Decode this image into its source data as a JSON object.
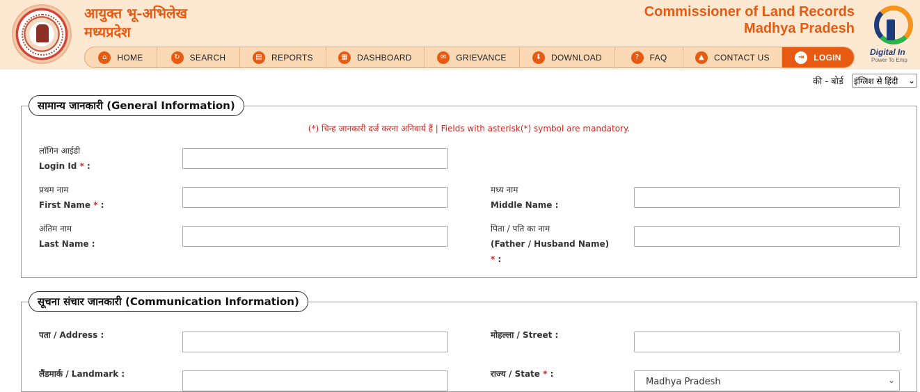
{
  "header": {
    "title_hi_line1": "आयुक्त भू-अभिलेख",
    "title_hi_line2": "मध्यप्रदेश",
    "title_en_line1": "Commissioner of Land Records",
    "title_en_line2": "Madhya Pradesh",
    "digital_india_text": "Digital In",
    "digital_india_sub": "Power To Emp"
  },
  "nav": {
    "items": [
      {
        "label": "HOME",
        "icon": "home-icon",
        "glyph": "⌂"
      },
      {
        "label": "SEARCH",
        "icon": "search-icon",
        "glyph": "↻"
      },
      {
        "label": "REPORTS",
        "icon": "reports-icon",
        "glyph": "▤"
      },
      {
        "label": "DASHBOARD",
        "icon": "dashboard-icon",
        "glyph": "▦"
      },
      {
        "label": "GRIEVANCE",
        "icon": "grievance-icon",
        "glyph": "✉"
      },
      {
        "label": "DOWNLOAD",
        "icon": "download-icon",
        "glyph": "⬇"
      },
      {
        "label": "FAQ",
        "icon": "faq-icon",
        "glyph": "?"
      },
      {
        "label": "CONTACT US",
        "icon": "contact-icon",
        "glyph": "▲"
      },
      {
        "label": "LOGIN",
        "icon": "login-icon",
        "glyph": "⇥"
      }
    ],
    "active_color": "#e65a12"
  },
  "keyboard": {
    "label": "की - बोर्ड",
    "selected": "इंग्लिश से हिंदी"
  },
  "general": {
    "legend": "सामान्य जानकारी (General Information)",
    "mandatory_note": "(*) चिन्ह जानकारी दर्ज करना अनिवार्य हैं | Fields with asterisk(*) symbol are mandatory.",
    "login_hi": "लॉगिन आईडी",
    "login_en": "Login Id",
    "first_hi": "प्रथम नाम",
    "first_en": "First Name",
    "middle_hi": "मध्य नाम",
    "middle_en": "Middle Name :",
    "last_hi": "अंतिम नाम",
    "last_en": "Last Name :",
    "father_hi": "पिता / पति का नाम",
    "father_en": "(Father / Husband Name)",
    "star": "*",
    "colon": " :"
  },
  "communication": {
    "legend": "सूचना संचार जानकारी (Communication Information)",
    "address_label": "पता / Address :",
    "street_label": "मोहल्ला / Street :",
    "landmark_label": "लैंडमार्क / Landmark :",
    "state_label": "राज्य / State",
    "state_value": "Madhya Pradesh"
  }
}
